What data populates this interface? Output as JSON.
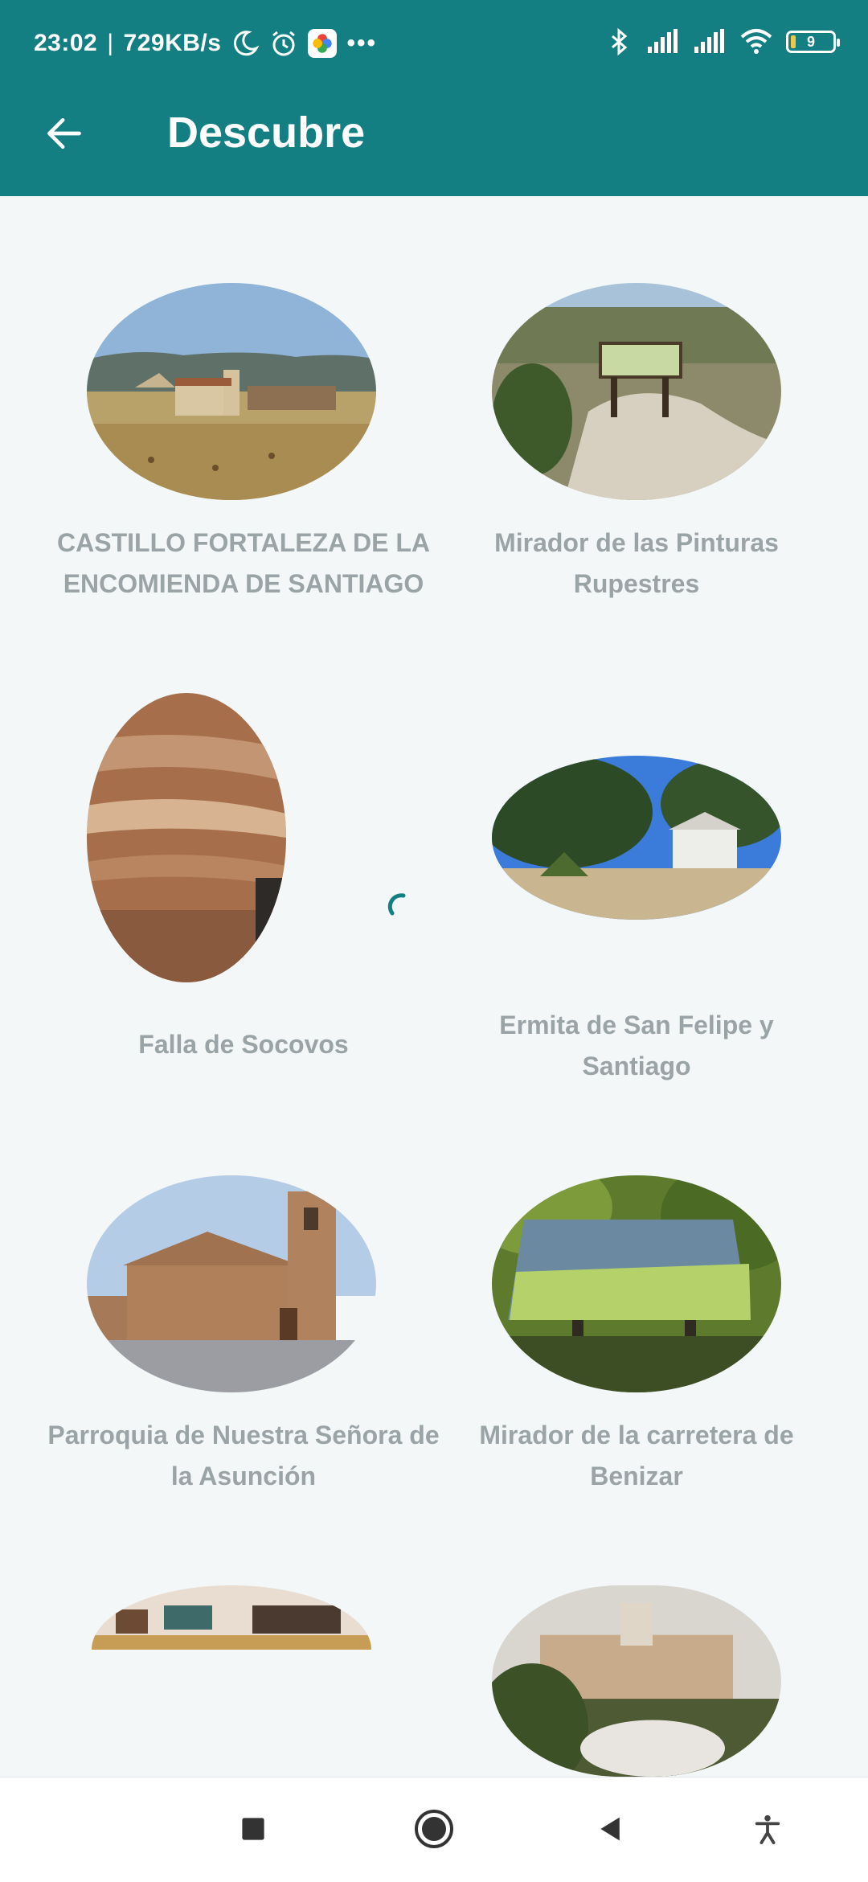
{
  "status_bar": {
    "time": "23:02",
    "speed": "729KB/s",
    "battery": "9",
    "icons": [
      "moon-icon",
      "alarm-icon",
      "photos-icon",
      "more-dots-icon",
      "bluetooth-icon",
      "signal-icon",
      "signal-icon",
      "wifi-icon",
      "battery-icon"
    ]
  },
  "app_bar": {
    "title": "Descubre",
    "back_icon": "arrow-left-icon"
  },
  "places": [
    {
      "name": "CASTILLO FORTALEZA DE LA ENCOMIENDA DE SANTIAGO"
    },
    {
      "name": "Mirador de las Pinturas Rupestres"
    },
    {
      "name": "Falla de Socovos"
    },
    {
      "name": "Ermita de San Felipe y Santiago"
    },
    {
      "name": "Parroquia de Nuestra Señora de la Asunción"
    },
    {
      "name": "Mirador de la carretera de Benizar"
    }
  ],
  "nav_bar": {
    "icons": [
      "square-icon",
      "circle-home-icon",
      "back-triangle-icon",
      "accessibility-icon"
    ]
  },
  "colors": {
    "primary": "#137f82",
    "background": "#f3f7f8",
    "caption": "#9aa3a6"
  }
}
